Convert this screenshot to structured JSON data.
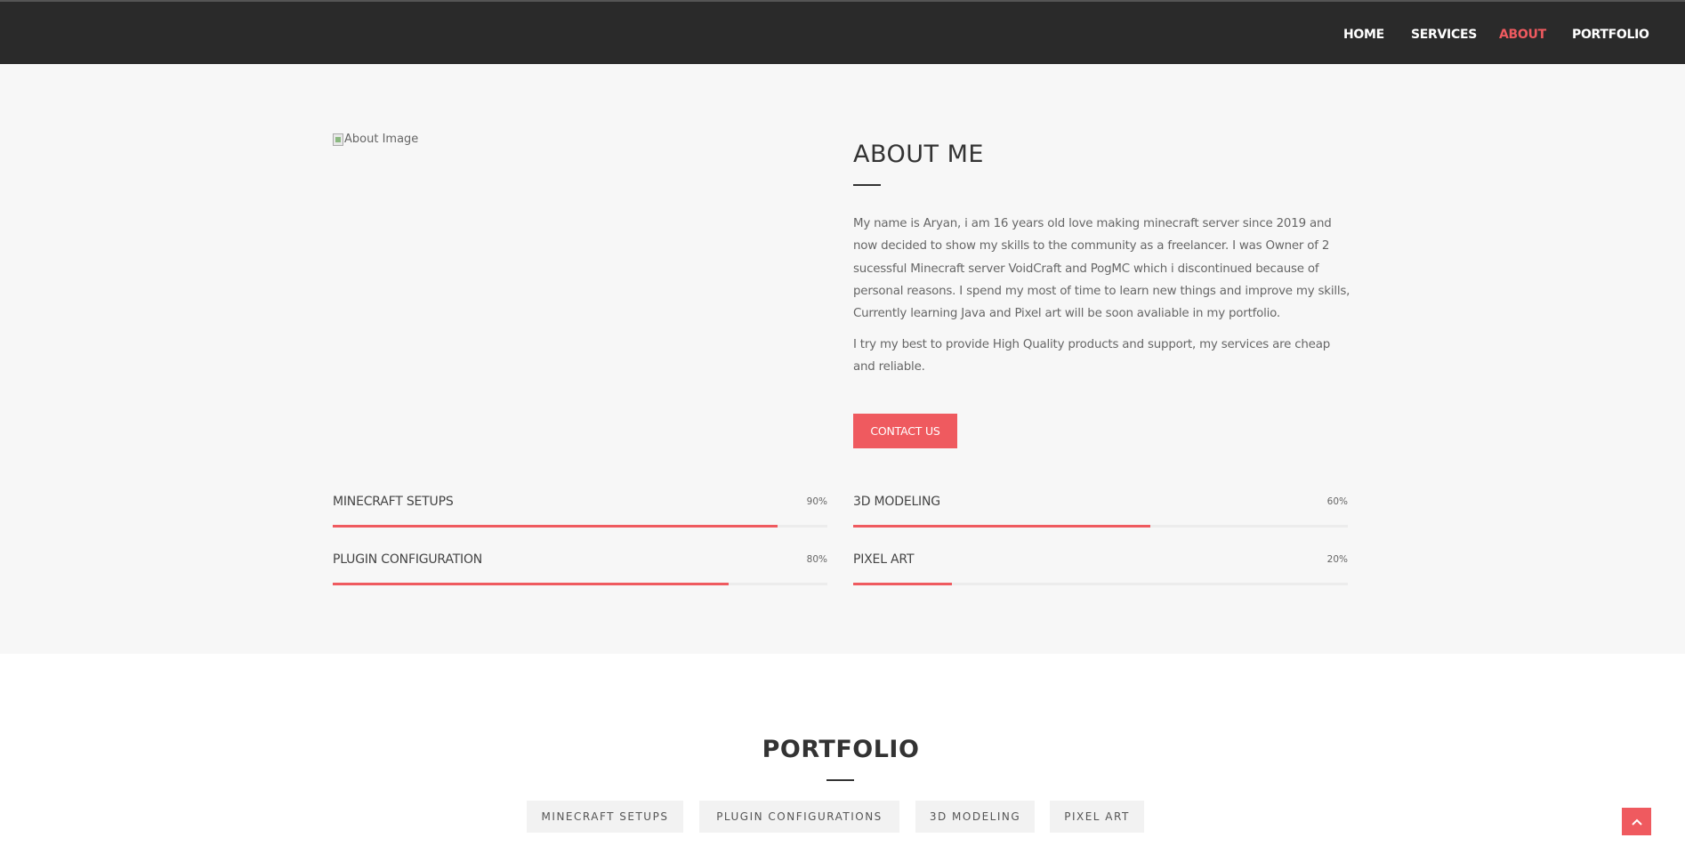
{
  "nav": {
    "items": [
      {
        "label": "HOME",
        "active": false
      },
      {
        "label": "SERVICES",
        "active": false
      },
      {
        "label": "ABOUT",
        "active": true
      },
      {
        "label": "PORTFOLIO",
        "active": false
      }
    ]
  },
  "about": {
    "image_alt": "About Image",
    "title": "ABOUT ME",
    "paragraph1": "My name is Aryan, i am 16 years old love making minecraft server since 2019 and now decided to show my skills to the community as a freelancer. I was Owner of 2 sucessful Minecraft server VoidCraft and PogMC which i discontinued because of personal reasons. I spend my most of time to learn new things and improve my skills, Currently learning Java and Pixel art will be soon avaliable in my portfolio.",
    "paragraph2": "I try my best to provide High Quality products and support, my services are cheap and reliable.",
    "contact_label": "CONTACT US"
  },
  "skills": [
    {
      "name": "MINECRAFT SETUPS",
      "percent_label": "90%",
      "percent": 90
    },
    {
      "name": "3D MODELING",
      "percent_label": "60%",
      "percent": 60
    },
    {
      "name": "PLUGIN CONFIGURATION",
      "percent_label": "80%",
      "percent": 80
    },
    {
      "name": "PIXEL ART",
      "percent_label": "20%",
      "percent": 20
    }
  ],
  "portfolio": {
    "title": "PORTFOLIO",
    "filters": [
      "MINECRAFT SETUPS",
      "PLUGIN CONFIGURATIONS",
      "3D MODELING",
      "PIXEL ART"
    ]
  },
  "colors": {
    "accent": "#ef5a5f",
    "navbar": "#2a2a2a",
    "section_bg": "#f7f7f7"
  },
  "icons": {
    "back_to_top": "chevron-up-icon",
    "broken_image": "broken-image-icon"
  }
}
